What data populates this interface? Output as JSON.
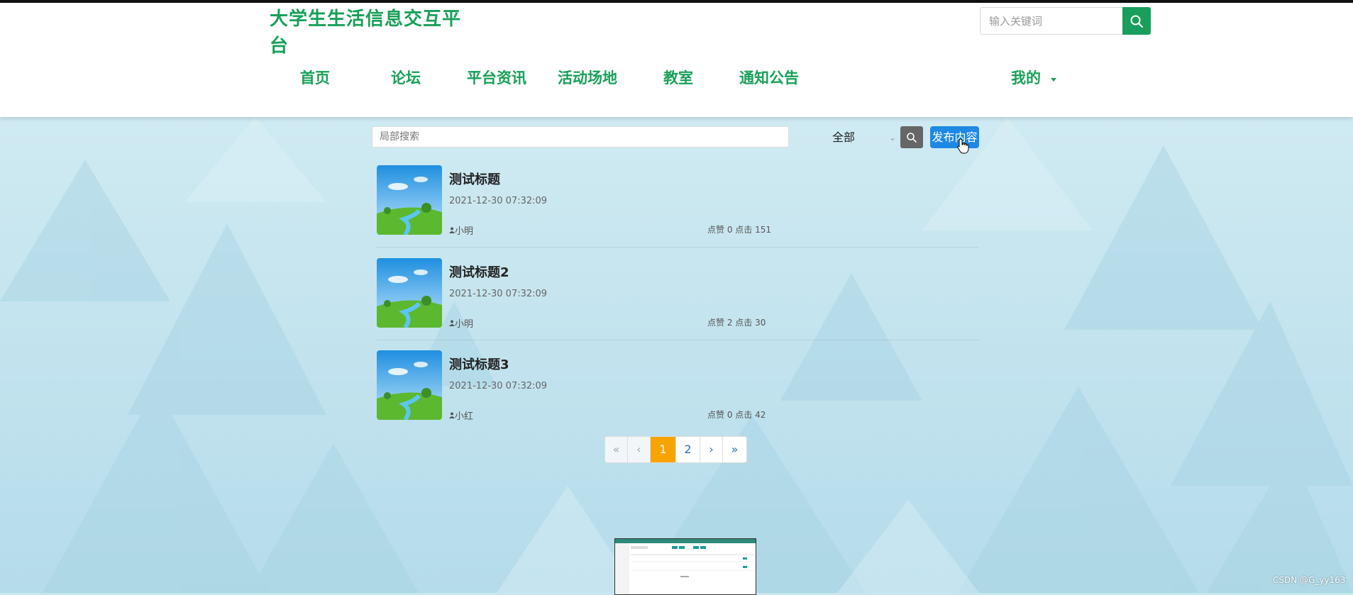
{
  "header": {
    "site_title": "大学生生活信息交互平台",
    "search_placeholder": "输入关键词",
    "nav": [
      "首页",
      "论坛",
      "平台资讯",
      "活动场地",
      "教室",
      "通知公告"
    ],
    "me_label": "我的"
  },
  "toolbar": {
    "search_placeholder": "局部搜索",
    "filter_selected": "全部",
    "publish_label": "发布内容"
  },
  "posts": [
    {
      "title": "测试标题",
      "date": "2021-12-30 07:32:09",
      "author": "小明",
      "stats": "点赞 0 点击 151"
    },
    {
      "title": "测试标题2",
      "date": "2021-12-30 07:32:09",
      "author": "小明",
      "stats": "点赞 2 点击 30"
    },
    {
      "title": "测试标题3",
      "date": "2021-12-30 07:32:09",
      "author": "小红",
      "stats": "点赞 0 点击 42"
    }
  ],
  "pagination": {
    "first": "«",
    "prev": "‹",
    "pages": [
      "1",
      "2"
    ],
    "current": "1",
    "next": "›",
    "last": "»"
  },
  "watermark": "CSDN @G_yy163",
  "colors": {
    "brand_green": "#18a058",
    "publish_blue": "#1e88e5",
    "page_active": "#f8a400",
    "background": "#c8e6ef"
  }
}
